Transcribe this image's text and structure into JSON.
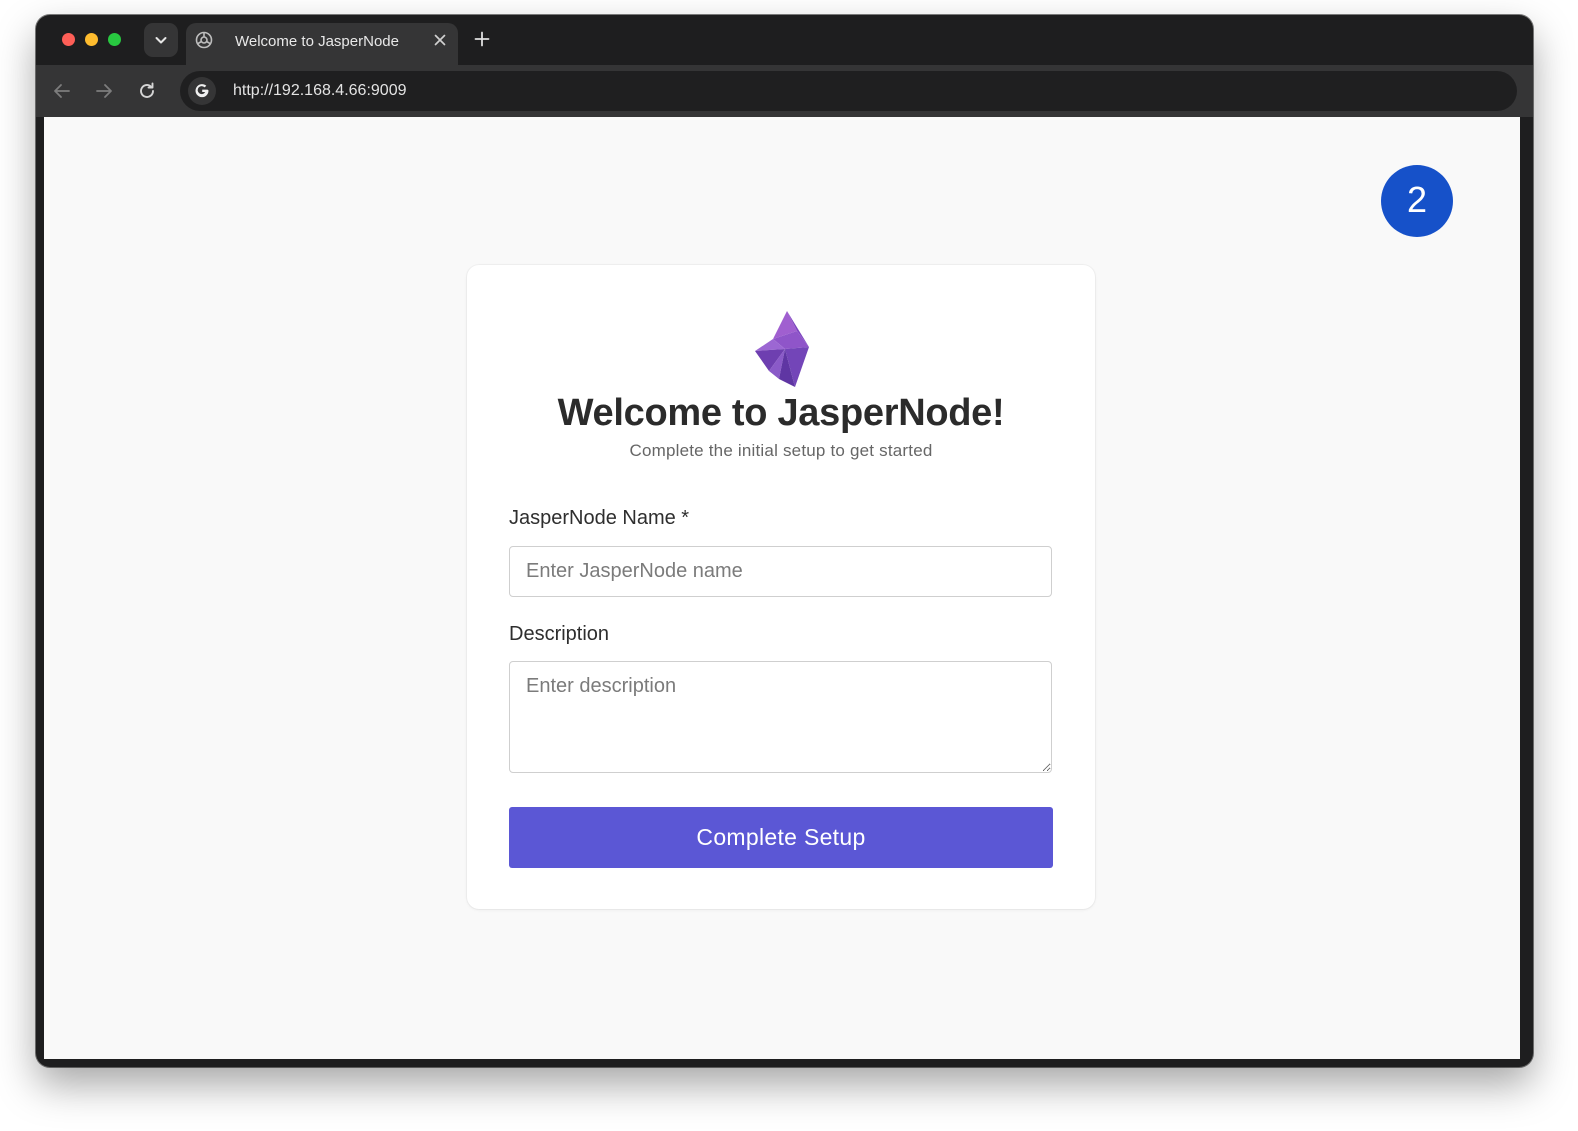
{
  "browser": {
    "tab_title": "Welcome to JasperNode",
    "url": "http://192.168.4.66:9009",
    "icons": {
      "tab_search": "chevron-down-icon",
      "favicon": "globe-icon",
      "close_tab": "close-icon",
      "new_tab": "plus-icon",
      "back": "arrow-left-icon",
      "forward": "arrow-right-icon",
      "reload": "reload-icon",
      "site_info": "google-g-icon"
    }
  },
  "page": {
    "step_badge": "2",
    "title": "Welcome to JasperNode!",
    "subtitle": "Complete the initial setup to get started",
    "form": {
      "name_label": "JasperNode Name *",
      "name_value": "",
      "name_placeholder": "Enter JasperNode name",
      "description_label": "Description",
      "description_value": "",
      "description_placeholder": "Enter description",
      "submit_label": "Complete Setup"
    }
  },
  "colors": {
    "accent": "#5b57d5",
    "badge": "#1651c9",
    "logo_primary": "#7b4fc4",
    "logo_secondary": "#9b6fd6"
  }
}
